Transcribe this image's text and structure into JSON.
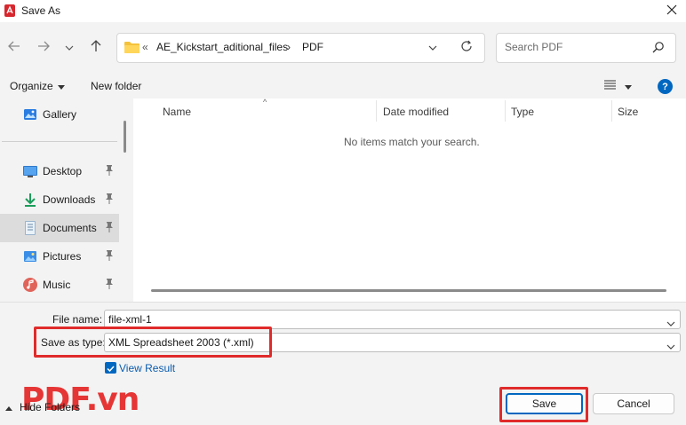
{
  "window": {
    "title": "Save As"
  },
  "address": {
    "prefix": "«",
    "crumbs": [
      "AE_Kickstart_aditional_files",
      "PDF"
    ],
    "separator": "›"
  },
  "search": {
    "placeholder": "Search PDF"
  },
  "toolbar": {
    "organize_label": "Organize",
    "new_folder_label": "New folder"
  },
  "sidebar": {
    "items": [
      {
        "label": "Gallery",
        "icon": "gallery-icon"
      },
      {
        "label": "Desktop",
        "icon": "desktop-icon",
        "pinned": true
      },
      {
        "label": "Downloads",
        "icon": "downloads-icon",
        "pinned": true
      },
      {
        "label": "Documents",
        "icon": "documents-icon",
        "pinned": true,
        "selected": true
      },
      {
        "label": "Pictures",
        "icon": "pictures-icon",
        "pinned": true
      },
      {
        "label": "Music",
        "icon": "music-icon",
        "pinned": true
      }
    ]
  },
  "filelist": {
    "columns": [
      "Name",
      "Date modified",
      "Type",
      "Size"
    ],
    "empty_message": "No items match your search."
  },
  "form": {
    "file_name_label": "File name:",
    "file_name_value": "file-xml-1",
    "save_type_label": "Save as type:",
    "save_type_value": "XML Spreadsheet 2003 (*.xml)",
    "view_result_label": "View Result",
    "view_result_checked": true
  },
  "footer": {
    "hide_folders_label": "Hide Folders",
    "save_label": "Save",
    "cancel_label": "Cancel",
    "watermark": "PDF.vn"
  },
  "colors": {
    "accent": "#0067c0",
    "highlight": "#e02b2b",
    "watermark": "#e63535"
  }
}
